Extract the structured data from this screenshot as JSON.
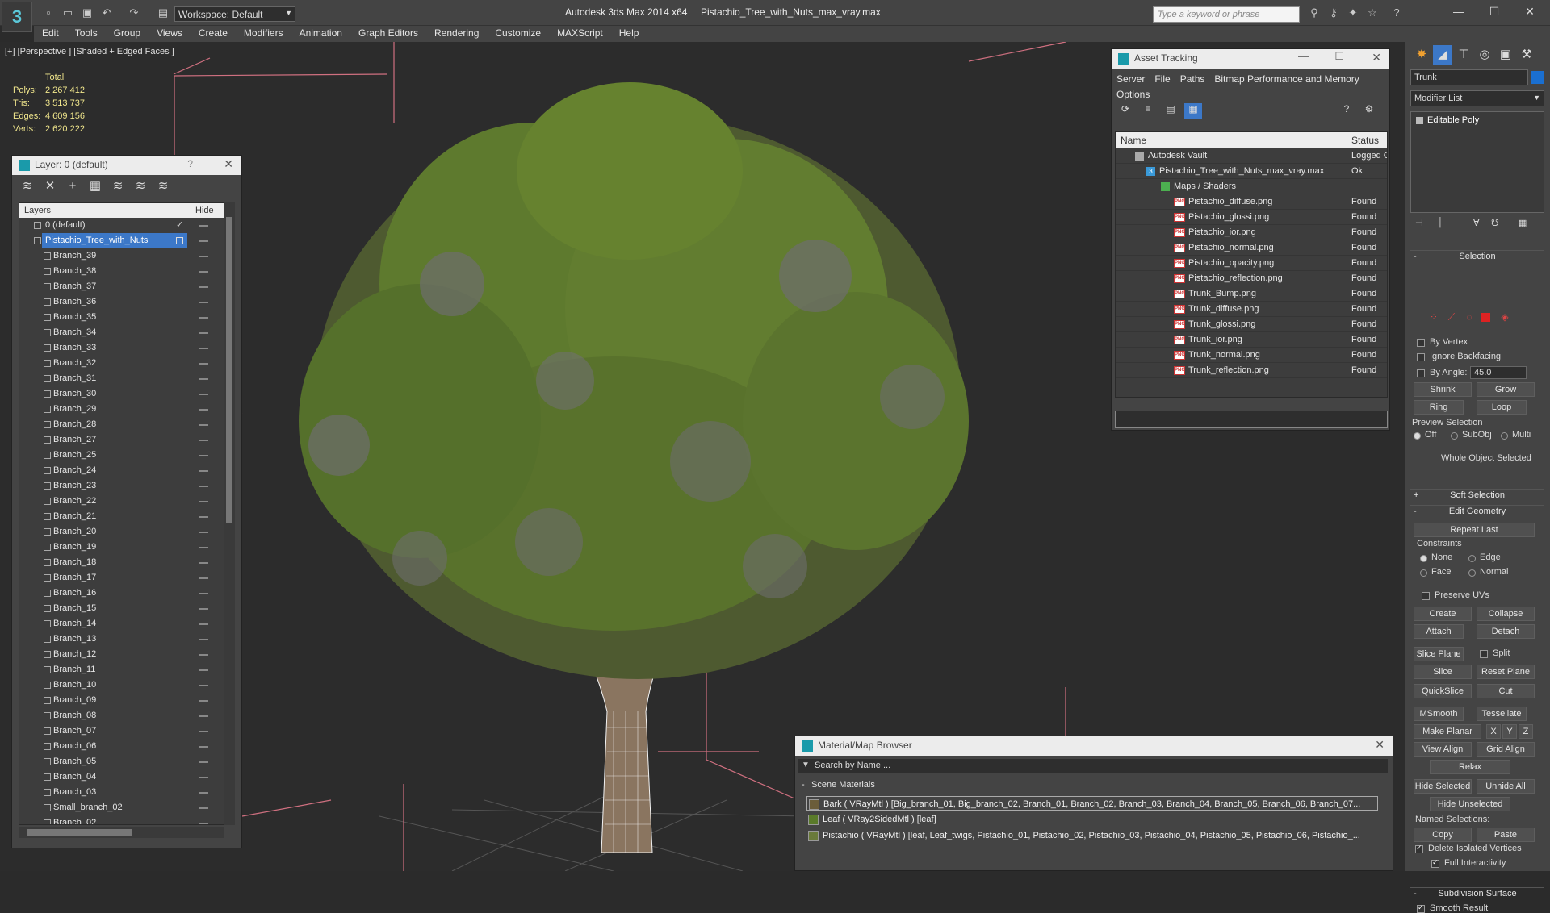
{
  "titlebar": {
    "workspace": "Workspace: Default",
    "app_title": "Autodesk 3ds Max  2014 x64",
    "file_title": "Pistachio_Tree_with_Nuts_max_vray.max",
    "search_placeholder": "Type a keyword or phrase"
  },
  "menu": [
    "Edit",
    "Tools",
    "Group",
    "Views",
    "Create",
    "Modifiers",
    "Animation",
    "Graph Editors",
    "Rendering",
    "Customize",
    "MAXScript",
    "Help"
  ],
  "viewport": {
    "label": "[+] [Perspective ] [Shaded + Edged Faces ]",
    "stats": {
      "total_label": "Total",
      "polys_label": "Polys:",
      "polys": "2 267 412",
      "tris_label": "Tris:",
      "tris": "3 513 737",
      "edges_label": "Edges:",
      "edges": "4 609 156",
      "verts_label": "Verts:",
      "verts": "2 620 222"
    }
  },
  "layer_panel": {
    "title": "Layer: 0 (default)",
    "help": "?",
    "col_layers": "Layers",
    "col_hide": "Hide",
    "top_rows": [
      "0 (default)",
      "Pistachio_Tree_with_Nuts"
    ],
    "rows": [
      "Branch_39",
      "Branch_38",
      "Branch_37",
      "Branch_36",
      "Branch_35",
      "Branch_34",
      "Branch_33",
      "Branch_32",
      "Branch_31",
      "Branch_30",
      "Branch_29",
      "Branch_28",
      "Branch_27",
      "Branch_25",
      "Branch_24",
      "Branch_23",
      "Branch_22",
      "Branch_21",
      "Branch_20",
      "Branch_19",
      "Branch_18",
      "Branch_17",
      "Branch_16",
      "Branch_15",
      "Branch_14",
      "Branch_13",
      "Branch_12",
      "Branch_11",
      "Branch_10",
      "Branch_09",
      "Branch_08",
      "Branch_07",
      "Branch_06",
      "Branch_05",
      "Branch_04",
      "Branch_03",
      "Small_branch_02",
      "Branch_02"
    ]
  },
  "asset_panel": {
    "title": "Asset Tracking",
    "menu": [
      "Server",
      "File",
      "Paths",
      "Bitmap Performance and Memory",
      "Options"
    ],
    "col_name": "Name",
    "col_status": "Status",
    "vault": {
      "name": "Autodesk Vault",
      "status": "Logged O"
    },
    "file": {
      "name": "Pistachio_Tree_with_Nuts_max_vray.max",
      "status": "Ok"
    },
    "maps_folder": "Maps / Shaders",
    "maps": [
      {
        "name": "Pistachio_diffuse.png",
        "status": "Found"
      },
      {
        "name": "Pistachio_glossi.png",
        "status": "Found"
      },
      {
        "name": "Pistachio_ior.png",
        "status": "Found"
      },
      {
        "name": "Pistachio_normal.png",
        "status": "Found"
      },
      {
        "name": "Pistachio_opacity.png",
        "status": "Found"
      },
      {
        "name": "Pistachio_reflection.png",
        "status": "Found"
      },
      {
        "name": "Trunk_Bump.png",
        "status": "Found"
      },
      {
        "name": "Trunk_diffuse.png",
        "status": "Found"
      },
      {
        "name": "Trunk_glossi.png",
        "status": "Found"
      },
      {
        "name": "Trunk_ior.png",
        "status": "Found"
      },
      {
        "name": "Trunk_normal.png",
        "status": "Found"
      },
      {
        "name": "Trunk_reflection.png",
        "status": "Found"
      }
    ]
  },
  "material_browser": {
    "title": "Material/Map Browser",
    "search_placeholder": "Search by Name ...",
    "section": "Scene Materials",
    "rows": [
      "Bark  ( VRayMtl )  [Big_branch_01, Big_branch_02, Branch_01, Branch_02, Branch_03, Branch_04, Branch_05, Branch_06, Branch_07...",
      "Leaf  ( VRay2SidedMtl )  [leaf]",
      "Pistachio  ( VRayMtl )  [leaf, Leaf_twigs, Pistachio_01, Pistachio_02, Pistachio_03, Pistachio_04, Pistachio_05, Pistachio_06, Pistachio_..."
    ]
  },
  "command_panel": {
    "object_name": "Trunk",
    "modifier_list": "Modifier List",
    "stack_item": "Editable Poly",
    "selection": "Selection",
    "by_vertex": "By Vertex",
    "ignore_backfacing": "Ignore Backfacing",
    "by_angle": "By Angle:",
    "angle_value": "45.0",
    "shrink": "Shrink",
    "grow": "Grow",
    "ring": "Ring",
    "loop": "Loop",
    "preview_selection": "Preview Selection",
    "off": "Off",
    "subobj": "SubObj",
    "multi": "Multi",
    "whole_object": "Whole Object Selected",
    "soft_selection": "Soft Selection",
    "edit_geometry": "Edit Geometry",
    "repeat_last": "Repeat Last",
    "constraints": "Constraints",
    "none": "None",
    "edge": "Edge",
    "face": "Face",
    "normal": "Normal",
    "preserve_uvs": "Preserve UVs",
    "create": "Create",
    "collapse": "Collapse",
    "attach": "Attach",
    "detach": "Detach",
    "slice_plane": "Slice Plane",
    "split": "Split",
    "slice": "Slice",
    "reset_plane": "Reset Plane",
    "quickslice": "QuickSlice",
    "cut": "Cut",
    "msmooth": "MSmooth",
    "tessellate": "Tessellate",
    "make_planar": "Make Planar",
    "x": "X",
    "y": "Y",
    "z": "Z",
    "view_align": "View Align",
    "grid_align": "Grid Align",
    "relax": "Relax",
    "hide_selected": "Hide Selected",
    "unhide_all": "Unhide All",
    "hide_unselected": "Hide Unselected",
    "named_selections": "Named Selections:",
    "copy": "Copy",
    "paste": "Paste",
    "delete_isolated": "Delete Isolated Vertices",
    "full_interactivity": "Full Interactivity",
    "subdivision_surface": "Subdivision Surface",
    "smooth_result": "Smooth Result"
  }
}
